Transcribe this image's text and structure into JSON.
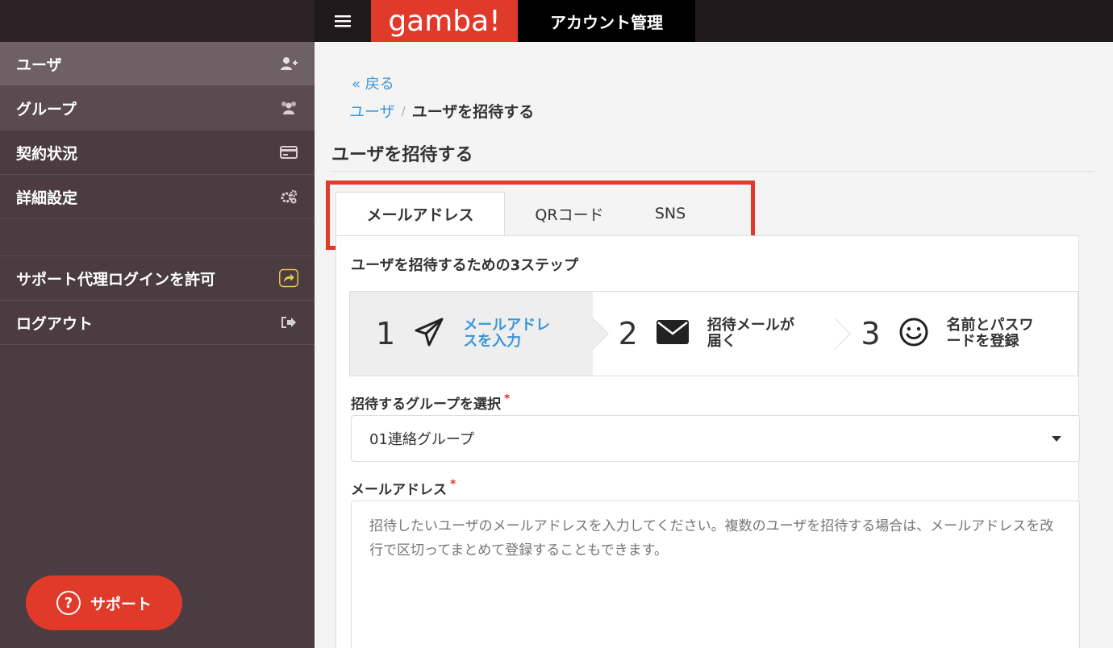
{
  "header": {
    "logo": "gamba!",
    "app_title": "アカウント管理"
  },
  "sidebar": {
    "items": [
      {
        "label": "ユーザ",
        "icon": "user-add-icon"
      },
      {
        "label": "グループ",
        "icon": "users-icon"
      },
      {
        "label": "契約状況",
        "icon": "credit-card-icon"
      },
      {
        "label": "詳細設定",
        "icon": "cogs-icon"
      }
    ],
    "support_login": {
      "label": "サポート代理ログインを許可",
      "icon": "share-icon"
    },
    "logout": {
      "label": "ログアウト",
      "icon": "sign-out-icon"
    },
    "support_button": "サポート"
  },
  "main": {
    "back_link": "« 戻る",
    "breadcrumb": {
      "parent": "ユーザ",
      "separator": "/",
      "current": "ユーザを招待する"
    },
    "page_title": "ユーザを招待する",
    "tabs": [
      {
        "label": "メールアドレス"
      },
      {
        "label": "QRコード"
      },
      {
        "label": "SNS"
      }
    ],
    "steps_title": "ユーザを招待するための3ステップ",
    "steps": [
      {
        "num": "1",
        "label": "メールアドレスを入力",
        "icon": "paper-plane-icon"
      },
      {
        "num": "2",
        "label": "招待メールが届く",
        "icon": "envelope-icon"
      },
      {
        "num": "3",
        "label": "名前とパスワードを登録",
        "icon": "smile-icon"
      }
    ],
    "group_field": {
      "label": "招待するグループを選択",
      "required_mark": "*",
      "value": "01連絡グループ"
    },
    "email_field": {
      "label": "メールアドレス",
      "required_mark": "*",
      "placeholder": "招待したいユーザのメールアドレスを入力してください。複数のユーザを招待する場合は、メールアドレスを改行で区切ってまとめて登録することもできます。"
    }
  },
  "colors": {
    "accent": "#e03a2b",
    "link": "#3a95d8",
    "sidebar": "#4a3c40"
  }
}
